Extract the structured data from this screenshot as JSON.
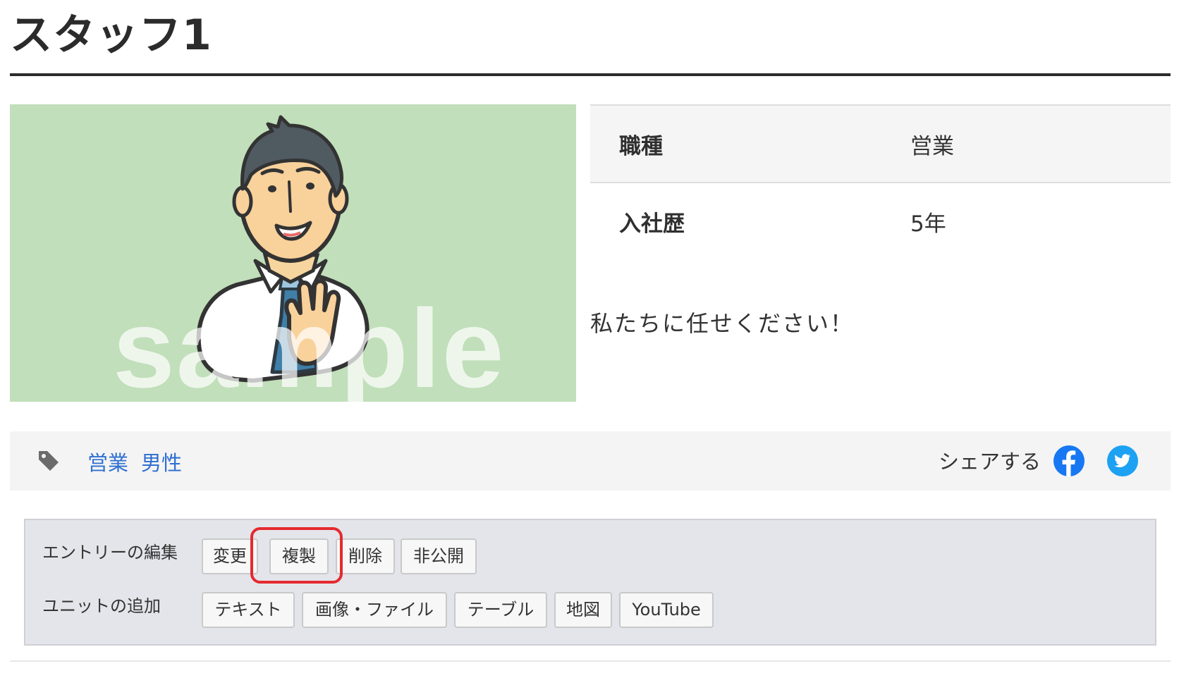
{
  "page": {
    "title": "スタッフ1"
  },
  "photo": {
    "watermark": "sample"
  },
  "info": {
    "rows": [
      {
        "key": "職種",
        "value": "営業"
      },
      {
        "key": "入社歴",
        "value": "5年"
      }
    ],
    "message": "私たちに任せください！"
  },
  "tags": {
    "items": [
      "営業",
      "男性"
    ],
    "share_label": "シェアする",
    "facebook_color": "#1877f2",
    "twitter_color": "#1da1f2"
  },
  "admin": {
    "entry_label": "エントリーの編集",
    "entry_buttons": [
      "変更",
      "複製",
      "削除",
      "非公開"
    ],
    "unit_label": "ユニットの追加",
    "unit_buttons": [
      "テキスト",
      "画像・ファイル",
      "テーブル",
      "地図",
      "YouTube"
    ],
    "highlight_color": "#e42a2f"
  }
}
